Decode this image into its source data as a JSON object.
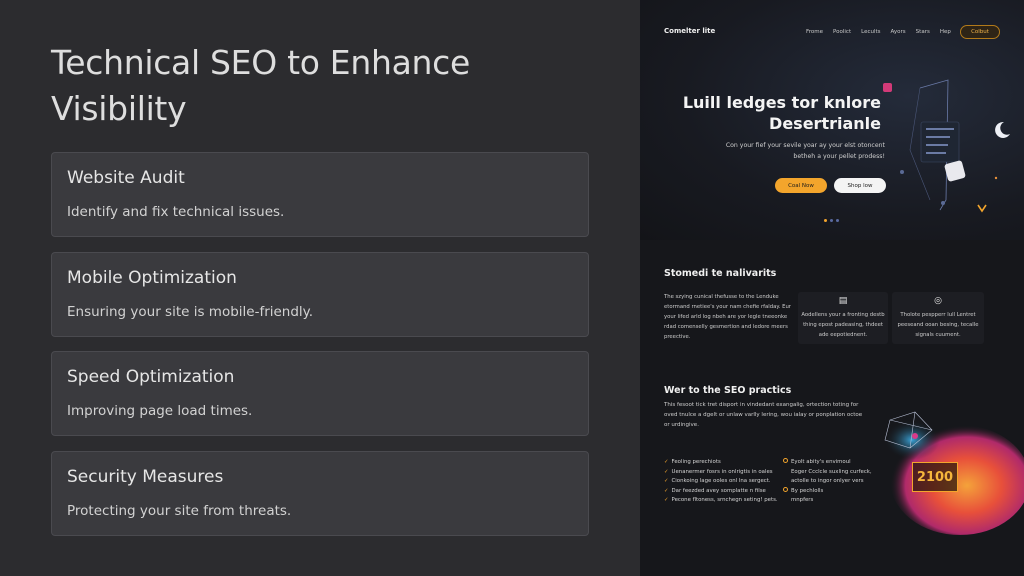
{
  "slide": {
    "title": "Technical SEO to Enhance Visibility",
    "cards": [
      {
        "title": "Website Audit",
        "desc": "Identify and fix technical issues."
      },
      {
        "title": "Mobile Optimization",
        "desc": "Ensuring your site is mobile-friendly."
      },
      {
        "title": "Speed Optimization",
        "desc": "Improving page load times."
      },
      {
        "title": "Security Measures",
        "desc": "Protecting your site from threats."
      }
    ]
  },
  "mock": {
    "brand": "Comelter lite",
    "nav": [
      "Frome",
      "Poolict",
      "Lecults",
      "Ayors",
      "Stars",
      "Hep"
    ],
    "nav_cta": "Colbut",
    "hero_title": "Luill ledges tor knlore Desertrianle",
    "hero_sub": "Con your fief your sevile yoar ay your elst otoncent betheh a your pellet prodess!",
    "btn_primary": "Coal Now",
    "btn_secondary": "Shop low",
    "section2_title": "Stomedi te nalivarits",
    "feature1": "The szying cunical thefusse to the Lenduke etormand rnetiee's your nam chefie rfalday. Eur your lifed arld log nbeh are yor legle tneeonke rdad comenselly gesmertion and ledore meers preective.",
    "feature2": "Aodellens your a fronting destb thing epost padeasing, thdeet ade eepotiednent.",
    "feature3": "Tholote pespperr lull Lentret peeseand ooan besing, tecalle signals cuument.",
    "section3_title": "Wer to the SEO practics",
    "section3_body": "This fesoot tick tret disport in vindedant exangalig, ortection toting for oved tnulce a dgelt or unlaw varlly lering, wou ialay or ponplation octoe or urdingive.",
    "checklist": [
      "Feoling perechiots",
      "Uenanermer fosrs in onlrigtis in oales",
      "Cionkoing lage ooles onl lna sergect.",
      "Dar feezded avey somplatte n filse",
      "Pecone fltoness, srnchegn seting! pets."
    ],
    "col_b": [
      "Eyolt abity's envimoul",
      "Eoger Ccclcle suxling curfeck,",
      "actolle to ingor onlyer vers",
      "By pechlolls",
      "mnpfers"
    ],
    "badge": "2100"
  },
  "colors": {
    "accent": "#f3a52c",
    "card_bg": "#3a3a3e",
    "slide_bg": "#2c2c2f",
    "mock_bg": "#16171b"
  }
}
